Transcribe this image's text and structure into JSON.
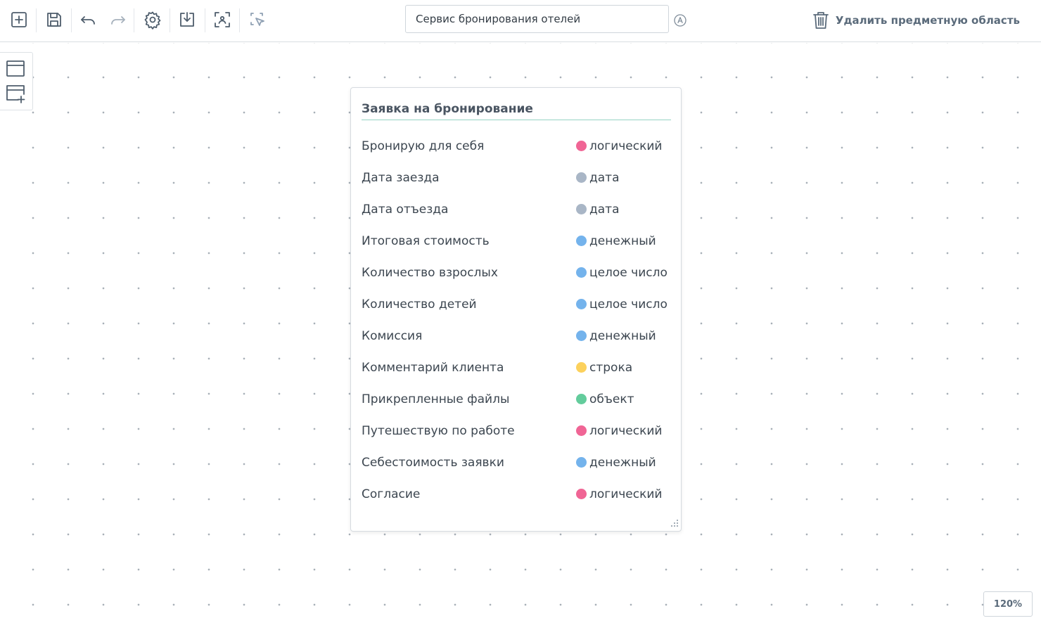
{
  "toolbar": {
    "icons": [
      "add-square-icon",
      "save-icon",
      "undo-icon",
      "redo-icon",
      "settings-icon",
      "download-icon",
      "fit-to-screen-icon",
      "pointer-edit-icon"
    ],
    "title_value": "Сервис бронирования отелей",
    "autosave_icon": "autosave-a-icon",
    "delete_label": "Удалить предметную область",
    "delete_icon": "trash-icon"
  },
  "side_panel": {
    "icons": [
      "entity-icon",
      "add-entity-icon"
    ]
  },
  "entity": {
    "title": "Заявка на бронирование",
    "attributes": [
      {
        "name": "Бронирую для себя",
        "type": "логический",
        "color": "#f06595"
      },
      {
        "name": "Дата заезда",
        "type": "дата",
        "color": "#a9b6c6"
      },
      {
        "name": "Дата отъезда",
        "type": "дата",
        "color": "#a9b6c6"
      },
      {
        "name": "Итоговая стоимость",
        "type": "денежный",
        "color": "#74b3ec"
      },
      {
        "name": "Количество взрослых",
        "type": "целое число",
        "color": "#74b3ec"
      },
      {
        "name": "Количество детей",
        "type": "целое число",
        "color": "#74b3ec"
      },
      {
        "name": "Комиссия",
        "type": "денежный",
        "color": "#74b3ec"
      },
      {
        "name": "Комментарий клиента",
        "type": "строка",
        "color": "#fcd15c"
      },
      {
        "name": "Прикрепленные файлы",
        "type": "объект",
        "color": "#63cc9c"
      },
      {
        "name": "Путешествую по работе",
        "type": "логический",
        "color": "#f06595"
      },
      {
        "name": "Себестоимость заявки",
        "type": "денежный",
        "color": "#74b3ec"
      },
      {
        "name": "Согласие",
        "type": "логический",
        "color": "#f06595"
      }
    ]
  },
  "zoom": {
    "label": "120%"
  }
}
